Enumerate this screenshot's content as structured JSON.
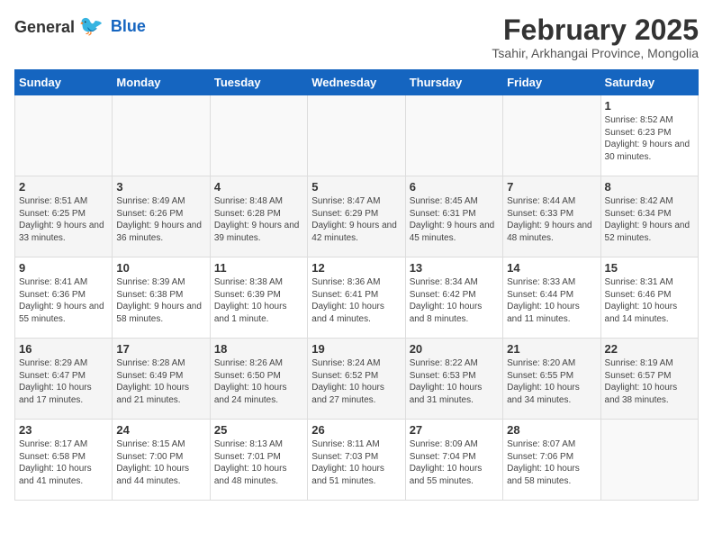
{
  "logo": {
    "general": "General",
    "blue": "Blue"
  },
  "title": {
    "month_year": "February 2025",
    "location": "Tsahir, Arkhangai Province, Mongolia"
  },
  "weekdays": [
    "Sunday",
    "Monday",
    "Tuesday",
    "Wednesday",
    "Thursday",
    "Friday",
    "Saturday"
  ],
  "weeks": [
    [
      {
        "day": "",
        "info": ""
      },
      {
        "day": "",
        "info": ""
      },
      {
        "day": "",
        "info": ""
      },
      {
        "day": "",
        "info": ""
      },
      {
        "day": "",
        "info": ""
      },
      {
        "day": "",
        "info": ""
      },
      {
        "day": "1",
        "info": "Sunrise: 8:52 AM\nSunset: 6:23 PM\nDaylight: 9 hours and 30 minutes."
      }
    ],
    [
      {
        "day": "2",
        "info": "Sunrise: 8:51 AM\nSunset: 6:25 PM\nDaylight: 9 hours and 33 minutes."
      },
      {
        "day": "3",
        "info": "Sunrise: 8:49 AM\nSunset: 6:26 PM\nDaylight: 9 hours and 36 minutes."
      },
      {
        "day": "4",
        "info": "Sunrise: 8:48 AM\nSunset: 6:28 PM\nDaylight: 9 hours and 39 minutes."
      },
      {
        "day": "5",
        "info": "Sunrise: 8:47 AM\nSunset: 6:29 PM\nDaylight: 9 hours and 42 minutes."
      },
      {
        "day": "6",
        "info": "Sunrise: 8:45 AM\nSunset: 6:31 PM\nDaylight: 9 hours and 45 minutes."
      },
      {
        "day": "7",
        "info": "Sunrise: 8:44 AM\nSunset: 6:33 PM\nDaylight: 9 hours and 48 minutes."
      },
      {
        "day": "8",
        "info": "Sunrise: 8:42 AM\nSunset: 6:34 PM\nDaylight: 9 hours and 52 minutes."
      }
    ],
    [
      {
        "day": "9",
        "info": "Sunrise: 8:41 AM\nSunset: 6:36 PM\nDaylight: 9 hours and 55 minutes."
      },
      {
        "day": "10",
        "info": "Sunrise: 8:39 AM\nSunset: 6:38 PM\nDaylight: 9 hours and 58 minutes."
      },
      {
        "day": "11",
        "info": "Sunrise: 8:38 AM\nSunset: 6:39 PM\nDaylight: 10 hours and 1 minute."
      },
      {
        "day": "12",
        "info": "Sunrise: 8:36 AM\nSunset: 6:41 PM\nDaylight: 10 hours and 4 minutes."
      },
      {
        "day": "13",
        "info": "Sunrise: 8:34 AM\nSunset: 6:42 PM\nDaylight: 10 hours and 8 minutes."
      },
      {
        "day": "14",
        "info": "Sunrise: 8:33 AM\nSunset: 6:44 PM\nDaylight: 10 hours and 11 minutes."
      },
      {
        "day": "15",
        "info": "Sunrise: 8:31 AM\nSunset: 6:46 PM\nDaylight: 10 hours and 14 minutes."
      }
    ],
    [
      {
        "day": "16",
        "info": "Sunrise: 8:29 AM\nSunset: 6:47 PM\nDaylight: 10 hours and 17 minutes."
      },
      {
        "day": "17",
        "info": "Sunrise: 8:28 AM\nSunset: 6:49 PM\nDaylight: 10 hours and 21 minutes."
      },
      {
        "day": "18",
        "info": "Sunrise: 8:26 AM\nSunset: 6:50 PM\nDaylight: 10 hours and 24 minutes."
      },
      {
        "day": "19",
        "info": "Sunrise: 8:24 AM\nSunset: 6:52 PM\nDaylight: 10 hours and 27 minutes."
      },
      {
        "day": "20",
        "info": "Sunrise: 8:22 AM\nSunset: 6:53 PM\nDaylight: 10 hours and 31 minutes."
      },
      {
        "day": "21",
        "info": "Sunrise: 8:20 AM\nSunset: 6:55 PM\nDaylight: 10 hours and 34 minutes."
      },
      {
        "day": "22",
        "info": "Sunrise: 8:19 AM\nSunset: 6:57 PM\nDaylight: 10 hours and 38 minutes."
      }
    ],
    [
      {
        "day": "23",
        "info": "Sunrise: 8:17 AM\nSunset: 6:58 PM\nDaylight: 10 hours and 41 minutes."
      },
      {
        "day": "24",
        "info": "Sunrise: 8:15 AM\nSunset: 7:00 PM\nDaylight: 10 hours and 44 minutes."
      },
      {
        "day": "25",
        "info": "Sunrise: 8:13 AM\nSunset: 7:01 PM\nDaylight: 10 hours and 48 minutes."
      },
      {
        "day": "26",
        "info": "Sunrise: 8:11 AM\nSunset: 7:03 PM\nDaylight: 10 hours and 51 minutes."
      },
      {
        "day": "27",
        "info": "Sunrise: 8:09 AM\nSunset: 7:04 PM\nDaylight: 10 hours and 55 minutes."
      },
      {
        "day": "28",
        "info": "Sunrise: 8:07 AM\nSunset: 7:06 PM\nDaylight: 10 hours and 58 minutes."
      },
      {
        "day": "",
        "info": ""
      }
    ]
  ]
}
